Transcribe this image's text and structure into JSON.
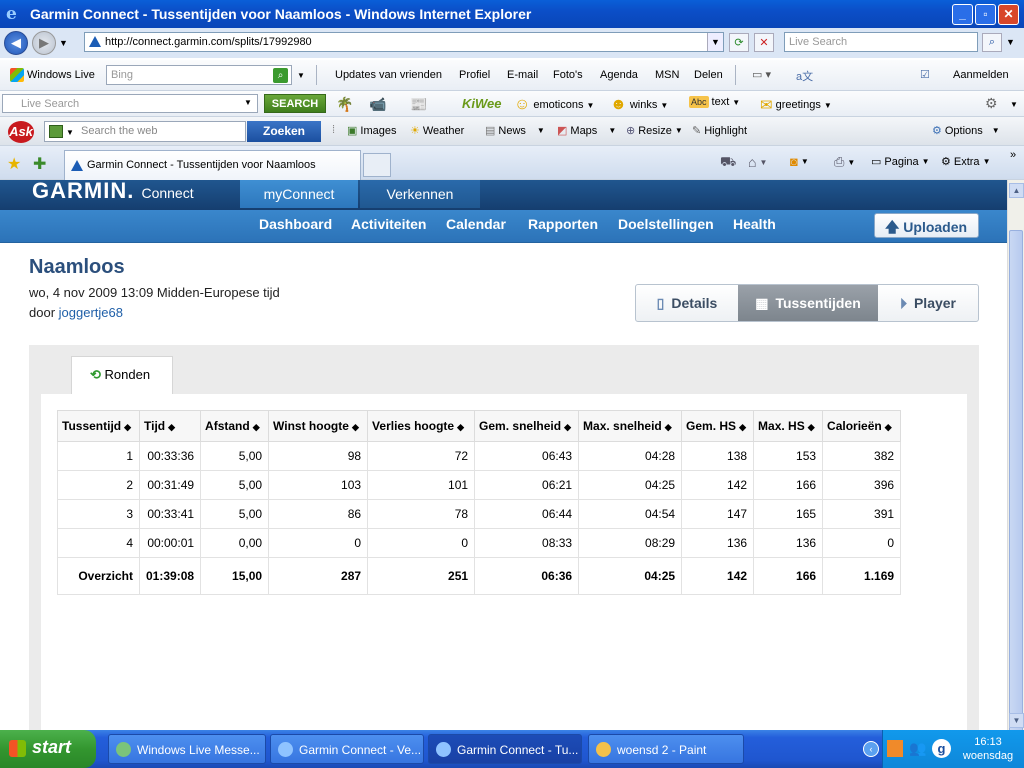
{
  "window": {
    "title": "Garmin Connect - Tussentijden voor Naamloos - Windows Internet Explorer"
  },
  "address": {
    "url": "http://connect.garmin.com/splits/17992980",
    "search_placeholder": "Live Search"
  },
  "toolbar_windowslive": {
    "brand": "Windows Live",
    "search_placeholder": "Bing",
    "items": [
      "Updates van vrienden",
      "Profiel",
      "E-mail",
      "Foto's",
      "Agenda",
      "MSN",
      "Delen"
    ],
    "signin": "Aanmelden"
  },
  "toolbar_livesearch": {
    "search_placeholder": "Live Search",
    "search_button": "SEARCH",
    "brand": "KiWee",
    "items": [
      "emoticons",
      "winks",
      "text",
      "greetings"
    ]
  },
  "toolbar_ask": {
    "brand": "Ask",
    "search_placeholder": "Search the web",
    "search_button": "Zoeken",
    "items": [
      "Images",
      "Weather",
      "News",
      "Maps",
      "Resize",
      "Highlight"
    ],
    "options": "Options"
  },
  "tabs": {
    "current": "Garmin Connect - Tussentijden voor Naamloos",
    "commands": [
      "Pagina",
      "Extra"
    ]
  },
  "garmin": {
    "logo": "GARMIN.",
    "logo_sub": "Connect",
    "top_nav": [
      "myConnect",
      "Verkennen"
    ],
    "sub_nav": [
      "Dashboard",
      "Activiteiten",
      "Calendar",
      "Rapporten",
      "Doelstellingen",
      "Health"
    ],
    "upload": "Uploaden"
  },
  "activity": {
    "title": "Naamloos",
    "date": "wo, 4 nov 2009 13:09 Midden-Europese tijd",
    "by_label": "door",
    "user": "joggertje68",
    "view_tabs": [
      "Details",
      "Tussentijden",
      "Player"
    ]
  },
  "panel": {
    "tab": "Ronden"
  },
  "splits": {
    "columns": [
      "Tussentijd",
      "Tijd",
      "Afstand",
      "Winst hoogte",
      "Verlies hoogte",
      "Gem. snelheid",
      "Max. snelheid",
      "Gem. HS",
      "Max. HS",
      "Calorieën"
    ],
    "rows": [
      [
        "1",
        "00:33:36",
        "5,00",
        "98",
        "72",
        "06:43",
        "04:28",
        "138",
        "153",
        "382"
      ],
      [
        "2",
        "00:31:49",
        "5,00",
        "103",
        "101",
        "06:21",
        "04:25",
        "142",
        "166",
        "396"
      ],
      [
        "3",
        "00:33:41",
        "5,00",
        "86",
        "78",
        "06:44",
        "04:54",
        "147",
        "165",
        "391"
      ],
      [
        "4",
        "00:00:01",
        "0,00",
        "0",
        "0",
        "08:33",
        "08:29",
        "136",
        "136",
        "0"
      ]
    ],
    "total": [
      "Overzicht",
      "01:39:08",
      "15,00",
      "287",
      "251",
      "06:36",
      "04:25",
      "142",
      "166",
      "1.169"
    ]
  },
  "taskbar": {
    "start": "start",
    "tasks": [
      "Windows Live Messe...",
      "Garmin Connect - Ve...",
      "Garmin Connect - Tu...",
      "woensd 2 - Paint"
    ],
    "time": "16:13",
    "day": "woensdag"
  }
}
